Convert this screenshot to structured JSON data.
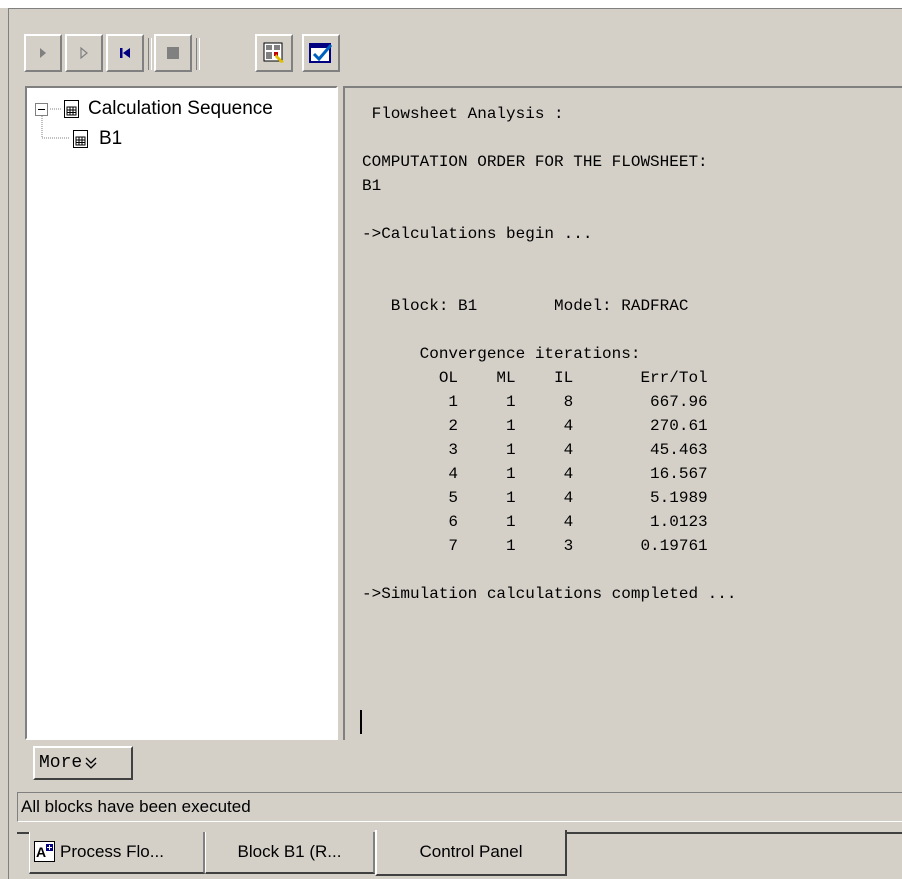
{
  "toolbar": {
    "buttons": [
      {
        "name": "run-icon"
      },
      {
        "name": "step-icon"
      },
      {
        "name": "reinitialize-icon"
      },
      {
        "name": "stop-icon"
      },
      {
        "name": "check-results-icon"
      },
      {
        "name": "check-status-icon"
      }
    ]
  },
  "tree": {
    "root_label": "Calculation Sequence",
    "child_label": "B1"
  },
  "output": {
    "text": " Flowsheet Analysis :\n\nCOMPUTATION ORDER FOR THE FLOWSHEET:\nB1\n\n->Calculations begin ...\n\n\n   Block: B1        Model: RADFRAC\n\n      Convergence iterations:\n        OL    ML    IL       Err/Tol\n         1     1     8        667.96\n         2     1     4        270.61\n         3     1     4        45.463\n         4     1     4        16.567\n         5     1     4        5.1989\n         6     1     4        1.0123\n         7     1     3       0.19761\n\n->Simulation calculations completed ..."
  },
  "more_button": {
    "label": "More"
  },
  "status": {
    "text": "All blocks have been executed"
  },
  "tabs": [
    {
      "label": "Process Flo..."
    },
    {
      "label": "Block B1 (R..."
    },
    {
      "label": "Control Panel"
    }
  ],
  "colors": {
    "face": "#d4d0c8",
    "accent": "#000080"
  }
}
